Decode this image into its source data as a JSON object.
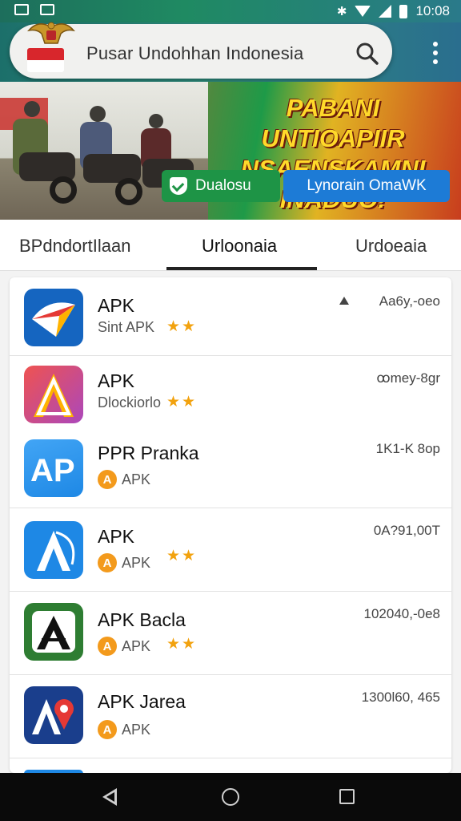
{
  "status_bar": {
    "time": "10:08"
  },
  "header": {
    "title": "Pusar Undohhan Indonesia"
  },
  "banner": {
    "headline_line1": "PABANI UNTIOAPIIR",
    "headline_line2": "NSAENSKAMNI INADUO!",
    "button_primary": "Dualosu",
    "button_secondary": "Lynorain OmaWK"
  },
  "tabs": [
    {
      "label": "BPdndortIlaan"
    },
    {
      "label": "Urloonaia",
      "active": true
    },
    {
      "label": "Urdoeaia"
    }
  ],
  "apps": [
    {
      "name": "APK",
      "subtitle": "Sint APK",
      "meta": "Aa6y,-oeo",
      "stars": "★★",
      "icon": "app-icon-kite",
      "colors": [
        "#1565c0",
        "#e53935",
        "#ffb300"
      ]
    },
    {
      "name": "APK",
      "subtitle": "Dlockiorlo",
      "meta": "ꝏmey-8gr",
      "stars": "★★",
      "icon": "app-icon-triangle",
      "colors": [
        "#e53935",
        "#ab47bc",
        "#ffb300"
      ]
    },
    {
      "name": "PPR Pranka",
      "subtitle": "APK",
      "meta": "1K1-K 8op",
      "stars": "",
      "icon": "app-icon-ap",
      "colors": [
        "#2196f3",
        "#ffffff"
      ]
    },
    {
      "name": "APK",
      "subtitle": "APK",
      "meta": "0A?91,00T",
      "stars": "★★",
      "icon": "app-icon-a-blue",
      "colors": [
        "#1e88e5",
        "#ffffff"
      ]
    },
    {
      "name": "APK Bacla",
      "subtitle": "APK",
      "meta": "102040,-0e8",
      "stars": "★★",
      "icon": "app-icon-a-green",
      "colors": [
        "#2e7d32",
        "#ffffff",
        "#111111"
      ]
    },
    {
      "name": "APK Jarea",
      "subtitle": "APK",
      "meta": "1300l60, 465",
      "stars": "",
      "icon": "app-icon-a-red",
      "colors": [
        "#1a3e8c",
        "#e53935",
        "#ffffff"
      ]
    }
  ],
  "accent": "#1d7bd6",
  "green": "#1e9446"
}
